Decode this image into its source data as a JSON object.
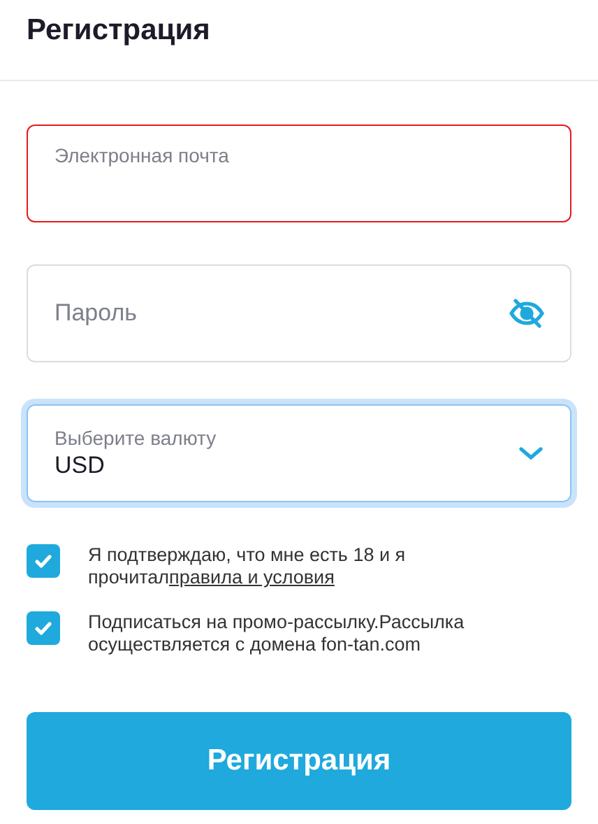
{
  "title": "Регистрация",
  "email": {
    "placeholder": "Электронная почта",
    "error": true
  },
  "password": {
    "placeholder": "Пароль",
    "hidden": true
  },
  "currency": {
    "label": "Выберите валюту",
    "value": "USD",
    "focused": true
  },
  "agreements": [
    {
      "checked": true,
      "text": "Я подтверждаю, что мне есть 18 и я прочитал",
      "link": "правила и условия"
    },
    {
      "checked": true,
      "text": "Подписаться на промо-рассылку.Рассылка осуществляется с домена fon-tan.com"
    }
  ],
  "submit": "Регистрация"
}
